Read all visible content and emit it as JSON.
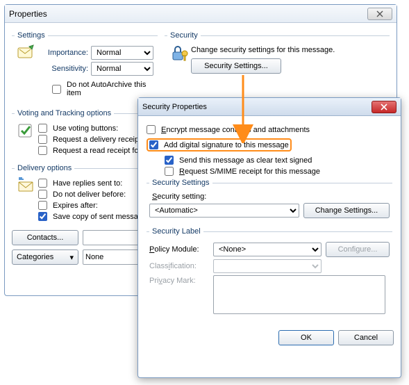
{
  "propWin": {
    "title": "Properties",
    "settings": {
      "legend": "Settings",
      "importanceLabel": "Importance:",
      "importanceValue": "Normal",
      "sensitivityLabel": "Sensitivity:",
      "sensitivityValue": "Normal",
      "autoArchive": "Do not AutoArchive this item"
    },
    "security": {
      "legend": "Security",
      "desc": "Change security settings for this message.",
      "button": "Security Settings..."
    },
    "voting": {
      "legend": "Voting and Tracking options",
      "useVoting": "Use voting buttons:",
      "deliveryReceipt": "Request a delivery receipt for this message",
      "readReceipt": "Request a read receipt for this message"
    },
    "delivery": {
      "legend": "Delivery options",
      "haveReplies": "Have replies sent to:",
      "notBefore": "Do not deliver before:",
      "expires": "Expires after:",
      "saveCopy": "Save copy of sent message"
    },
    "contacts": "Contacts...",
    "categories": "Categories",
    "categoriesValue": "None"
  },
  "secWin": {
    "title": "Security Properties",
    "encrypt": "Encrypt message contents and attachments",
    "sign": "Add digital signature to this message",
    "clearText": "Send this message as clear text signed",
    "smime": "Request S/MIME receipt for this message",
    "settings": {
      "legend": "Security Settings",
      "label": "Security setting:",
      "value": "<Automatic>",
      "change": "Change Settings..."
    },
    "label": {
      "legend": "Security Label",
      "policy": "Policy Module:",
      "policyValue": "<None>",
      "configure": "Configure...",
      "classification": "Classification:",
      "privacy": "Privacy Mark:"
    },
    "ok": "OK",
    "cancel": "Cancel"
  }
}
